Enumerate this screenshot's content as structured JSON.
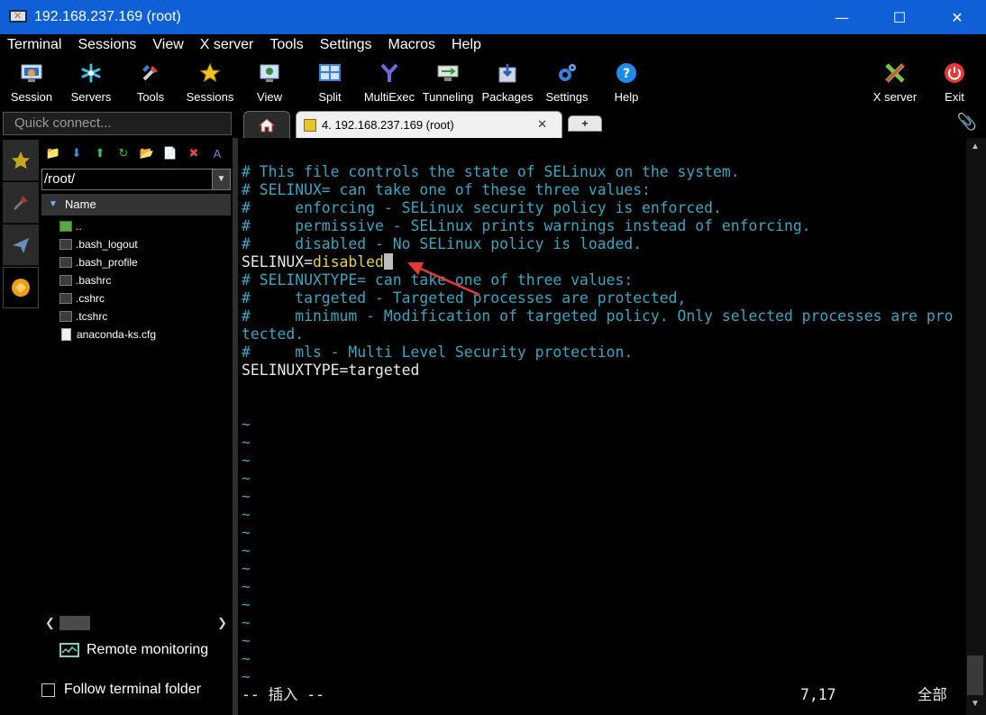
{
  "window": {
    "title": "192.168.237.169 (root)",
    "minimize": "—",
    "maximize": "☐",
    "close": "✕"
  },
  "menu": [
    "Terminal",
    "Sessions",
    "View",
    "X server",
    "Tools",
    "Settings",
    "Macros",
    "Help"
  ],
  "toolbar": {
    "items": [
      {
        "label": "Session",
        "icon": "session-icon"
      },
      {
        "label": "Servers",
        "icon": "servers-icon"
      },
      {
        "label": "Tools",
        "icon": "tools-icon"
      },
      {
        "label": "Sessions",
        "icon": "star-icon"
      },
      {
        "label": "View",
        "icon": "view-icon"
      },
      {
        "label": "Split",
        "icon": "split-icon"
      },
      {
        "label": "MultiExec",
        "icon": "multiexec-icon"
      },
      {
        "label": "Tunneling",
        "icon": "tunneling-icon"
      },
      {
        "label": "Packages",
        "icon": "packages-icon"
      },
      {
        "label": "Settings",
        "icon": "settings-icon"
      },
      {
        "label": "Help",
        "icon": "help-icon"
      }
    ],
    "right_items": [
      {
        "label": "X server",
        "icon": "xserver-icon"
      },
      {
        "label": "Exit",
        "icon": "exit-icon"
      }
    ]
  },
  "quick_connect": {
    "placeholder": "Quick connect..."
  },
  "tabs": {
    "session_tab": "4. 192.168.237.169 (root)",
    "close": "✕",
    "new_tab": "+"
  },
  "sidebar": {
    "path": "/root/",
    "column_header": "Name",
    "files": [
      {
        "name": "..",
        "type": "up"
      },
      {
        "name": ".bash_logout",
        "type": "file"
      },
      {
        "name": ".bash_profile",
        "type": "file"
      },
      {
        "name": ".bashrc",
        "type": "file"
      },
      {
        "name": ".cshrc",
        "type": "file"
      },
      {
        "name": ".tcshrc",
        "type": "file"
      },
      {
        "name": "anaconda-ks.cfg",
        "type": "doc"
      }
    ],
    "remote_monitoring": "Remote monitoring",
    "follow_terminal_folder": "Follow terminal folder"
  },
  "terminal": {
    "lines": [
      {
        "text": "# This file controls the state of SELinux on the system.",
        "style": "comment"
      },
      {
        "text": "# SELINUX= can take one of these three values:",
        "style": "comment"
      },
      {
        "text": "#     enforcing - SELinux security policy is enforced.",
        "style": "comment"
      },
      {
        "text": "#     permissive - SELinux prints warnings instead of enforcing.",
        "style": "comment"
      },
      {
        "text": "#     disabled - No SELinux policy is loaded.",
        "style": "comment"
      },
      {
        "key": "SELINUX=",
        "value": "disabled",
        "style": "setting",
        "cursor": true
      },
      {
        "text": "# SELINUXTYPE= can take one of three values:",
        "style": "comment"
      },
      {
        "text": "#     targeted - Targeted processes are protected,",
        "style": "comment"
      },
      {
        "text": "#     minimum - Modification of targeted policy. Only selected processes are pro",
        "style": "comment"
      },
      {
        "text": "tected.",
        "style": "comment"
      },
      {
        "text": "#     mls - Multi Level Security protection.",
        "style": "comment"
      },
      {
        "text": "SELINUXTYPE=targeted",
        "style": "normal"
      }
    ],
    "tilde": "~",
    "tilde_count": 15,
    "status_mode": "-- 插入 --",
    "status_position": "7,17",
    "status_scope": "全部",
    "colors": {
      "comment": "#3aa6c0",
      "value": "#e5d34a",
      "normal": "#e8e8e8"
    }
  },
  "annotation": {
    "type": "red-arrow",
    "color": "#e53935"
  }
}
